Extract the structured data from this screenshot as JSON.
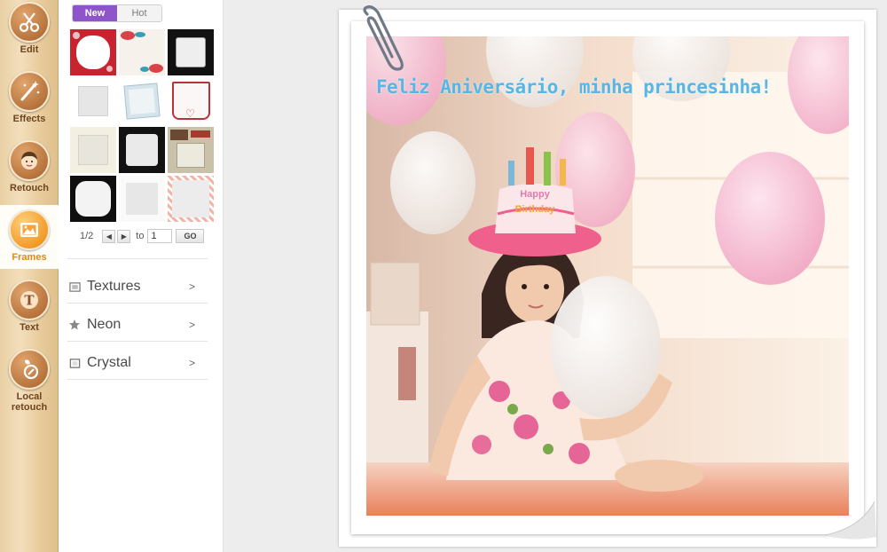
{
  "tools": [
    {
      "label": "Edit",
      "icon": "scissors-icon"
    },
    {
      "label": "Effects",
      "icon": "magic-wand-icon"
    },
    {
      "label": "Retouch",
      "icon": "face-icon"
    },
    {
      "label": "Frames",
      "icon": "picture-frame-icon",
      "active": true
    },
    {
      "label": "Text",
      "icon": "text-t-icon"
    },
    {
      "label": "Local retouch",
      "icon": "local-brush-icon"
    }
  ],
  "frames_panel": {
    "tabs": {
      "new": "New",
      "hot": "Hot"
    },
    "active_tab": "New",
    "pager": {
      "page": "1/2",
      "to_label": "to",
      "input_value": "1",
      "go_label": "GO"
    },
    "categories": [
      {
        "label": "Textures",
        "arrow": ">",
        "icon": "texture-icon"
      },
      {
        "label": "Neon",
        "arrow": ">",
        "icon": "neon-star-icon"
      },
      {
        "label": "Crystal",
        "arrow": ">",
        "icon": "crystal-square-icon"
      }
    ]
  },
  "canvas": {
    "caption": "Feliz Aniversário, minha princesinha!",
    "hat_text_1": "Happy",
    "hat_text_2": "Birthday"
  },
  "colors": {
    "accent_purple": "#8f54c9",
    "active_orange": "#e8870f",
    "wood": "#e9cfa3",
    "caption_blue": "#56b7e6"
  }
}
